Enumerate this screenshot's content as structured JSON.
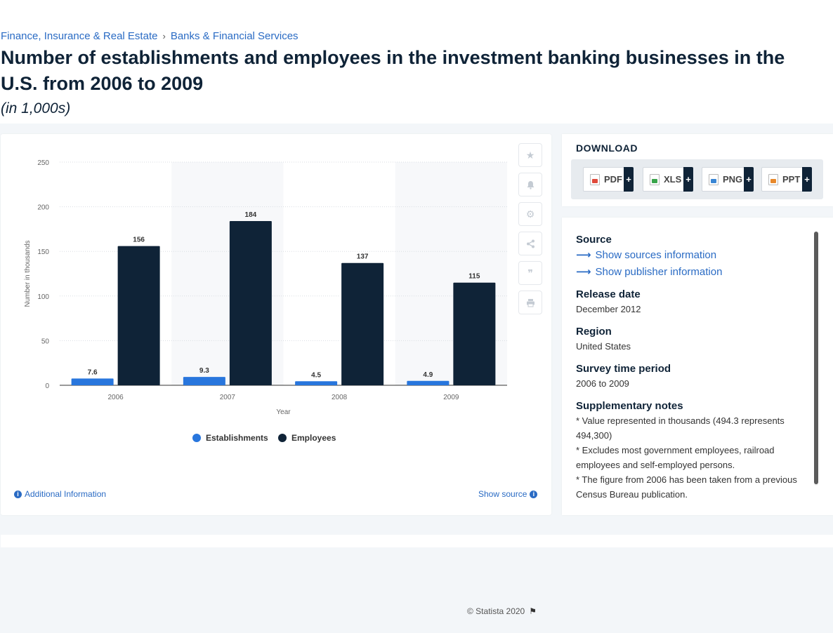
{
  "breadcrumb": {
    "items": [
      "Finance, Insurance & Real Estate",
      "Banks & Financial Services"
    ],
    "separator": "›"
  },
  "title": "Number of establishments and employees in the investment banking businesses in the U.S. from 2006 to 2009",
  "subtitle": "(in 1,000s)",
  "chart_data": {
    "type": "bar",
    "categories": [
      "2006",
      "2007",
      "2008",
      "2009"
    ],
    "series": [
      {
        "name": "Establishments",
        "color": "#2876dd",
        "values": [
          7.6,
          9.3,
          4.5,
          4.9
        ]
      },
      {
        "name": "Employees",
        "color": "#0f2337",
        "values": [
          156,
          184,
          137,
          115
        ]
      }
    ],
    "xlabel": "Year",
    "ylabel": "Number in thousands",
    "ylim": [
      0,
      250
    ],
    "yticks": [
      0,
      50,
      100,
      150,
      200,
      250
    ],
    "grid": true,
    "legend": "bottom-center",
    "data_labels": true
  },
  "chart_footer": {
    "credit": "© Statista 2020",
    "additional_info": "Additional Information",
    "show_source": "Show source"
  },
  "side_tools": [
    "star-icon",
    "bell-icon",
    "gear-icon",
    "share-icon",
    "quote-icon",
    "print-icon"
  ],
  "download": {
    "title": "DOWNLOAD",
    "buttons": [
      {
        "label": "PDF",
        "icon": "pdf-file-icon"
      },
      {
        "label": "XLS",
        "icon": "xls-file-icon"
      },
      {
        "label": "PNG",
        "icon": "png-file-icon"
      },
      {
        "label": "PPT",
        "icon": "ppt-file-icon"
      }
    ],
    "plus": "+"
  },
  "source_panel": {
    "source_heading": "Source",
    "show_sources": "Show sources information",
    "show_publisher": "Show publisher information",
    "release_heading": "Release date",
    "release_value": "December 2012",
    "region_heading": "Region",
    "region_value": "United States",
    "survey_heading": "Survey time period",
    "survey_value": "2006 to 2009",
    "notes_heading": "Supplementary notes",
    "notes": [
      "* Value represented in thousands (494.3 represents 494,300)",
      "* Excludes most government employees, railroad employees and self-employed persons.",
      "* The figure from 2006 has been taken from a previous Census Bureau publication."
    ]
  }
}
